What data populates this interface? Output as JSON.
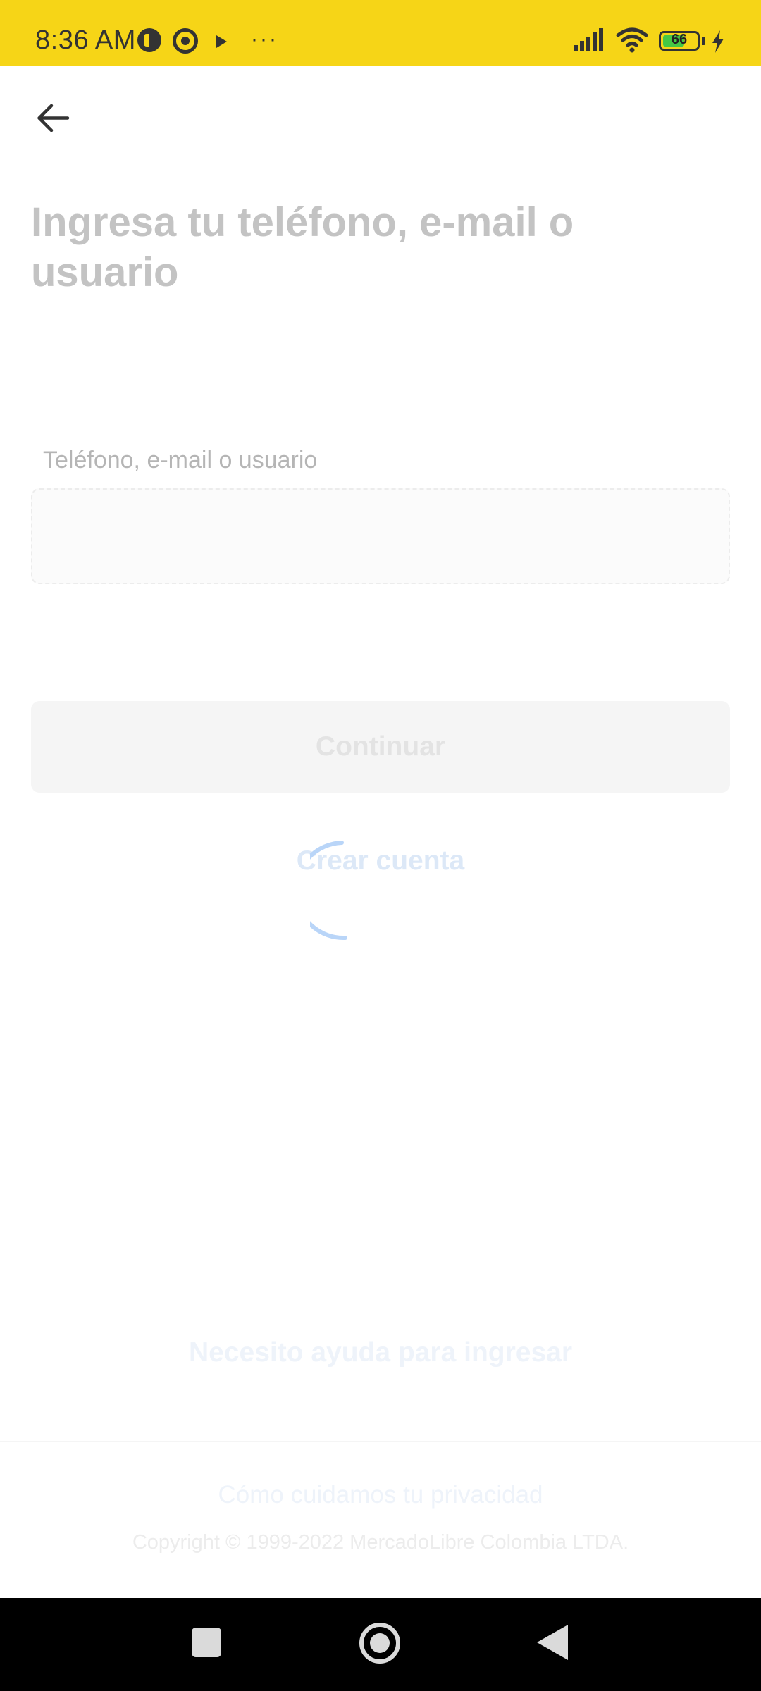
{
  "status_bar": {
    "time": "8:36 AM",
    "battery_level": "66",
    "battery_fraction": 0.66,
    "background_color": "#f6d517",
    "icons": [
      "app-notification-icon",
      "sync-icon",
      "play-icon",
      "more-dots-icon",
      "signal-icon",
      "wifi-icon",
      "battery-icon",
      "charging-icon"
    ],
    "more_dots": "···"
  },
  "header": {
    "back_icon": "arrow-left-icon"
  },
  "main": {
    "title": "Ingresa tu teléfono, e-mail o usuario",
    "field_label": "Teléfono, e-mail o usuario",
    "field_value": "",
    "continue_label": "Continuar",
    "create_account_label": "Crear cuenta",
    "loading_spinner": "loading-spinner-icon",
    "accent_color": "#3483fa"
  },
  "help": {
    "label": "Necesito ayuda para ingresar"
  },
  "footer": {
    "privacy_label": "Cómo cuidamos tu privacidad",
    "copyright": "Copyright © 1999-2022 MercadoLibre Colombia LTDA."
  },
  "nav_bar": {
    "icons": [
      "recents-icon",
      "home-icon",
      "back-icon"
    ]
  }
}
